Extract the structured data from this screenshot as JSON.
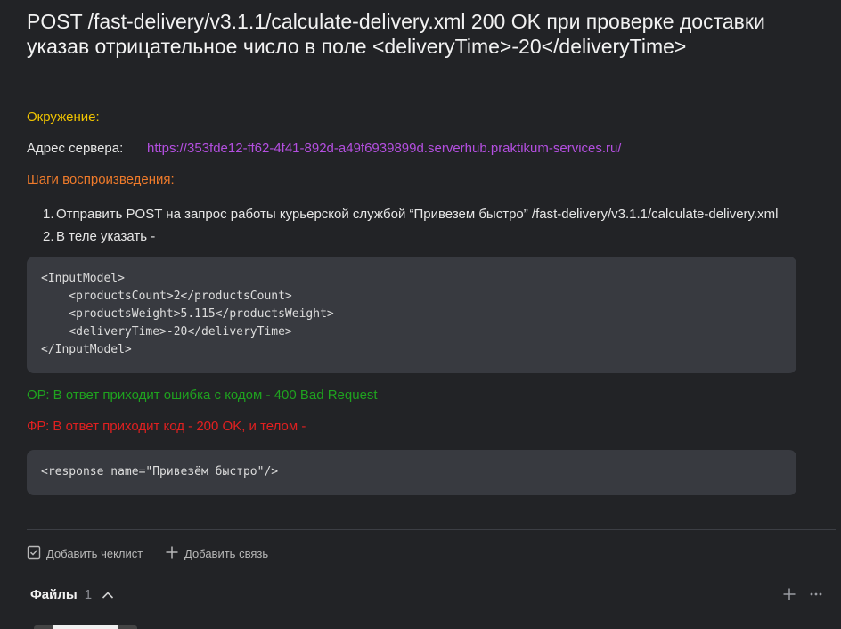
{
  "title": "POST /fast-delivery/v3.1.1/calculate-delivery.xml 200 OK при проверке доставки указав отрицательное число в поле <deliveryTime>-20</deliveryTime>",
  "environment": {
    "label": "Окружение:",
    "server_label": "Адрес сервера:",
    "server_url": "https://353fde12-ff62-4f41-892d-a49f6939899d.serverhub.praktikum-services.ru/"
  },
  "steps": {
    "label": "Шаги воспроизведения:",
    "items": [
      {
        "num": "1.",
        "text": "Отправить POST на запрос работы курьерской службой “Привезем быстро” /fast-delivery/v3.1.1/calculate-delivery.xml"
      },
      {
        "num": "2.",
        "text": "В теле указать -"
      }
    ]
  },
  "request_body": "<InputModel>\n    <productsCount>2</productsCount>\n    <productsWeight>5.115</productsWeight>\n    <deliveryTime>-20</deliveryTime>\n</InputModel>",
  "expected_result": "ОР: В ответ приходит ошибка с кодом - 400 Bad Request",
  "actual_result": "ФР: В ответ приходит код - 200 OK, и телом -",
  "response_body": "<response name=\"Привезём быстро\"/>",
  "actions": {
    "add_checklist": "Добавить чеклист",
    "add_link": "Добавить связь"
  },
  "files": {
    "title": "Файлы",
    "count": "1"
  },
  "colors": {
    "background": "#222326",
    "environment_label": "#f2c500",
    "steps_label": "#f07b2b",
    "link": "#b44fe0",
    "expected": "#1fa31f",
    "actual": "#e02020",
    "code_bg": "#383a40"
  },
  "icons": {
    "checklist": "checkbox-icon",
    "link": "plus-icon",
    "files_toggle": "chevron-up-icon",
    "files_add": "plus-icon",
    "files_more": "more-horizontal-icon"
  }
}
